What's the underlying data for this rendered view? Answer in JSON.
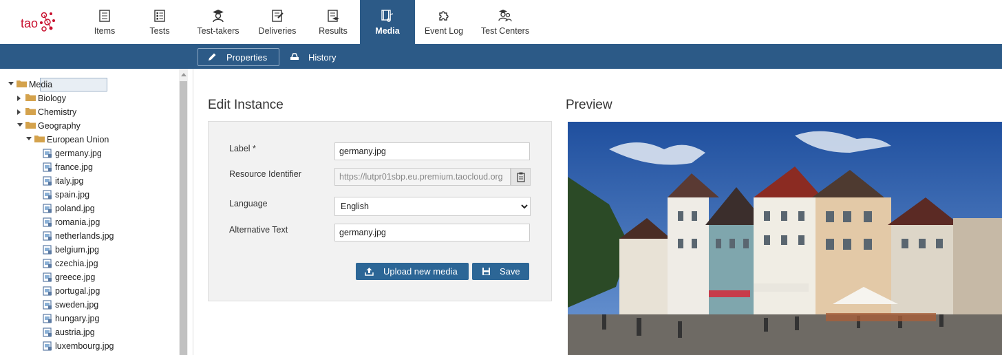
{
  "logo": {
    "text": "tao"
  },
  "nav": {
    "items": [
      {
        "label": "Items",
        "icon": "items-icon"
      },
      {
        "label": "Tests",
        "icon": "tests-icon"
      },
      {
        "label": "Test-takers",
        "icon": "test-takers-icon"
      },
      {
        "label": "Deliveries",
        "icon": "deliveries-icon"
      },
      {
        "label": "Results",
        "icon": "results-icon"
      },
      {
        "label": "Media",
        "icon": "media-icon",
        "active": true
      },
      {
        "label": "Event Log",
        "icon": "puzzle-icon"
      },
      {
        "label": "Test Centers",
        "icon": "test-centers-icon"
      }
    ]
  },
  "actions": {
    "properties_label": "Properties",
    "history_label": "History"
  },
  "tree": {
    "root": "Media",
    "folders": [
      "Biology",
      "Chemistry",
      "Geography",
      "European Union"
    ],
    "files": [
      "germany.jpg",
      "france.jpg",
      "italy.jpg",
      "spain.jpg",
      "poland.jpg",
      "romania.jpg",
      "netherlands.jpg",
      "belgium.jpg",
      "czechia.jpg",
      "greece.jpg",
      "portugal.jpg",
      "sweden.jpg",
      "hungary.jpg",
      "austria.jpg",
      "luxembourg.jpg"
    ]
  },
  "form": {
    "title": "Edit Instance",
    "label_label": "Label *",
    "label_value": "germany.jpg",
    "resource_label": "Resource Identifier",
    "resource_value": "https://lutpr01sbp.eu.premium.taocloud.org",
    "language_label": "Language",
    "language_value": "English",
    "alt_label": "Alternative Text",
    "alt_value": "germany.jpg",
    "upload_label": "Upload new media",
    "save_label": "Save"
  },
  "preview": {
    "title": "Preview"
  },
  "colors": {
    "primary": "#2c5a87",
    "button": "#2c6696",
    "brand": "#c8102e"
  }
}
